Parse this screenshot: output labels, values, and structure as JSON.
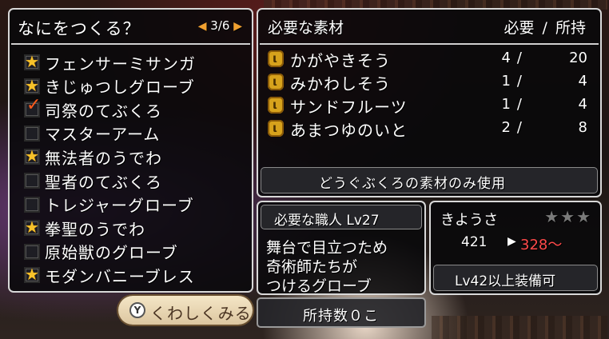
{
  "left_panel": {
    "title": "なにをつくる？",
    "pager": "3/6",
    "items": [
      {
        "label": "フェンサーミサンガ",
        "mark": "star"
      },
      {
        "label": "きじゅつしグローブ",
        "mark": "star"
      },
      {
        "label": "司祭のてぶくろ",
        "mark": "check"
      },
      {
        "label": "マスターアーム",
        "mark": "none"
      },
      {
        "label": "無法者のうでわ",
        "mark": "star"
      },
      {
        "label": "聖者のてぶくろ",
        "mark": "none"
      },
      {
        "label": "トレジャーグローブ",
        "mark": "none"
      },
      {
        "label": "拳聖のうでわ",
        "mark": "star"
      },
      {
        "label": "原始獣のグローブ",
        "mark": "none"
      },
      {
        "label": "モダンバニーブレス",
        "mark": "star"
      }
    ]
  },
  "materials": {
    "title": "必要な素材",
    "col_header": "必要 / 所持",
    "rows": [
      {
        "name": "かがやきそう",
        "need": "4",
        "have": "20"
      },
      {
        "name": "みかわしそう",
        "need": "1",
        "have": "4"
      },
      {
        "name": "サンドフルーツ",
        "need": "1",
        "have": "4"
      },
      {
        "name": "あまつゆのいと",
        "need": "2",
        "have": "8"
      }
    ],
    "bag_only_label": "どうぐぶくろの素材のみ使用"
  },
  "craft_info": {
    "header": "必要な職人 Lv27",
    "desc": [
      "舞台で目立つため",
      "奇術師たちが",
      "つけるグローブ"
    ]
  },
  "owned": "所持数０こ",
  "skill": {
    "label": "きようさ",
    "stars": "★★★",
    "stars_filled": 0,
    "base": "421",
    "arrow": "▶",
    "next": "328～",
    "equip": "Lv42以上装備可"
  },
  "detail_button": {
    "key": "Y",
    "label": "くわしくみる"
  },
  "colors": {
    "accent_orange": "#f0a030",
    "star_gold": "#f7c22a",
    "check_red": "#ff5b1a",
    "next_value_red": "#ff4a4a"
  }
}
